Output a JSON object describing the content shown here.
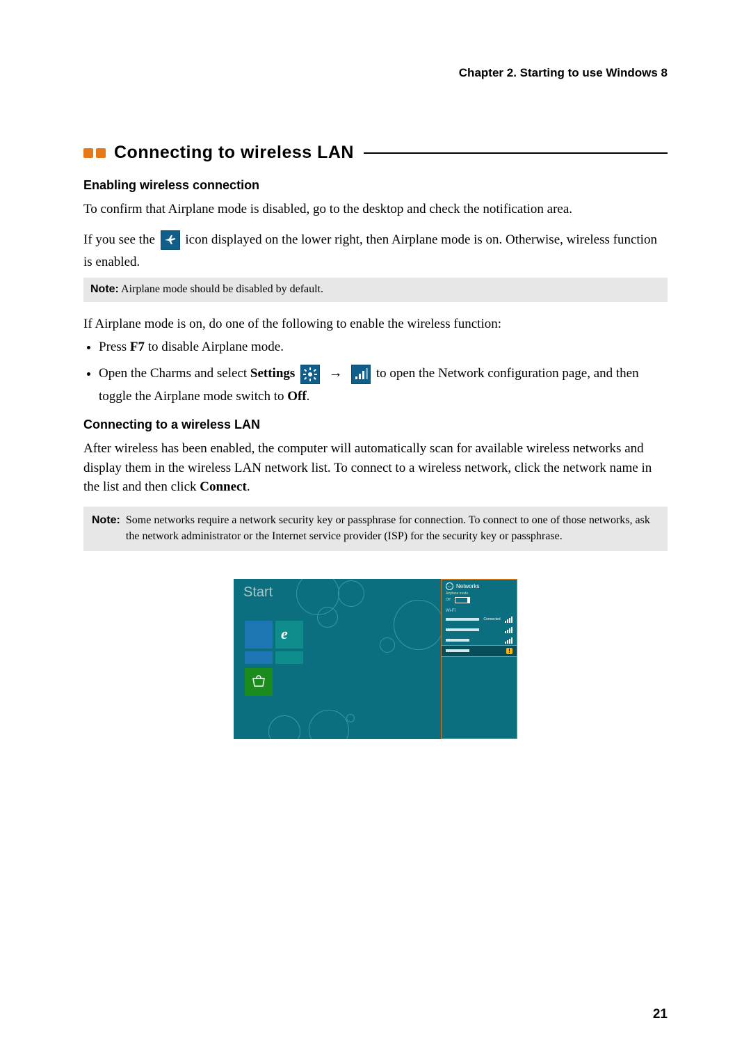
{
  "header": {
    "chapter": "Chapter 2. Starting to use Windows 8"
  },
  "section": {
    "title": "Connecting to wireless LAN"
  },
  "sub1": {
    "heading": "Enabling wireless connection",
    "p1": "To confirm that Airplane mode is disabled, go to the desktop and check the notification area.",
    "p2_pre": "If you see the ",
    "p2_post": " icon displayed on the lower right, then Airplane mode is on. Otherwise, wireless function is enabled."
  },
  "note1": {
    "label": "Note:",
    "text": " Airplane mode should be disabled by default."
  },
  "p3": "If Airplane mode is on, do one of the following to enable the wireless function:",
  "bullets": {
    "b1_pre": "Press ",
    "b1_key": "F7",
    "b1_post": " to disable Airplane mode.",
    "b2_pre": "Open the Charms and select ",
    "b2_settings": "Settings",
    "b2_mid": "  to open the Network configuration page, and then toggle the Airplane mode switch to ",
    "b2_off": "Off",
    "arrow": "→"
  },
  "sub2": {
    "heading": "Connecting to a wireless LAN",
    "p1_pre": "After wireless has been enabled, the computer will automatically scan for available wireless networks and display them in the wireless LAN network list. To connect to a wireless network, click the network name in the list and then click ",
    "p1_connect": "Connect",
    "p1_post": "."
  },
  "note2": {
    "label": "Note:",
    "text": "Some networks require a network security key or passphrase for connection. To connect to one of those networks, ask the network administrator or the Internet service provider (ISP) for the security key or passphrase."
  },
  "screenshot": {
    "start": "Start",
    "networks_title": "Networks",
    "airplane_label": "Airplane mode",
    "airplane_state": "Off",
    "wifi_label": "Wi-Fi",
    "connected": "Connected"
  },
  "page_number": "21"
}
